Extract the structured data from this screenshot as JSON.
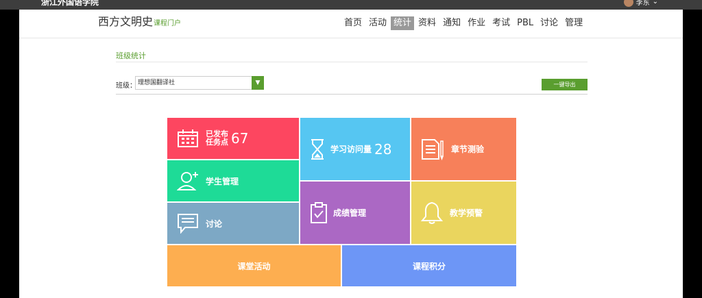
{
  "topbar": {
    "school": "浙江外国语学院",
    "user": "李东",
    "chevron": "⌄"
  },
  "header": {
    "course_title": "西方文明史",
    "course_sub": "课程门户",
    "nav": [
      "首页",
      "活动",
      "统计",
      "资料",
      "通知",
      "作业",
      "考试",
      "PBL",
      "讨论",
      "管理"
    ],
    "active_nav": "统计"
  },
  "section": {
    "title": "班级统计"
  },
  "filter": {
    "label": "班级：",
    "selected": "理想国翻译社",
    "export_label": "一键导出"
  },
  "tiles": {
    "published": {
      "label_line1": "已发布",
      "label_line2": "任务点",
      "value": "67",
      "color": "#fd4660"
    },
    "visits": {
      "label": "学习访问量",
      "value": "28",
      "color": "#56c6f2"
    },
    "chapter_quiz": {
      "label": "章节测验",
      "color": "#f7805a"
    },
    "students": {
      "label": "学生管理",
      "color": "#1edb97"
    },
    "grades": {
      "label": "成绩管理",
      "color": "#ab68c4"
    },
    "warning": {
      "label": "教学预警",
      "color": "#ead55e"
    },
    "discussion": {
      "label": "讨论",
      "color": "#7da8c5"
    },
    "class_activity": {
      "label": "课堂活动",
      "color": "#fdae50"
    },
    "course_points": {
      "label": "课程积分",
      "color": "#6d96f6"
    }
  },
  "icons": [
    "calendar-icon",
    "hourglass-icon",
    "document-pen-icon",
    "add-user-icon",
    "clipboard-check-icon",
    "bell-icon",
    "chat-icon",
    "avatar"
  ]
}
